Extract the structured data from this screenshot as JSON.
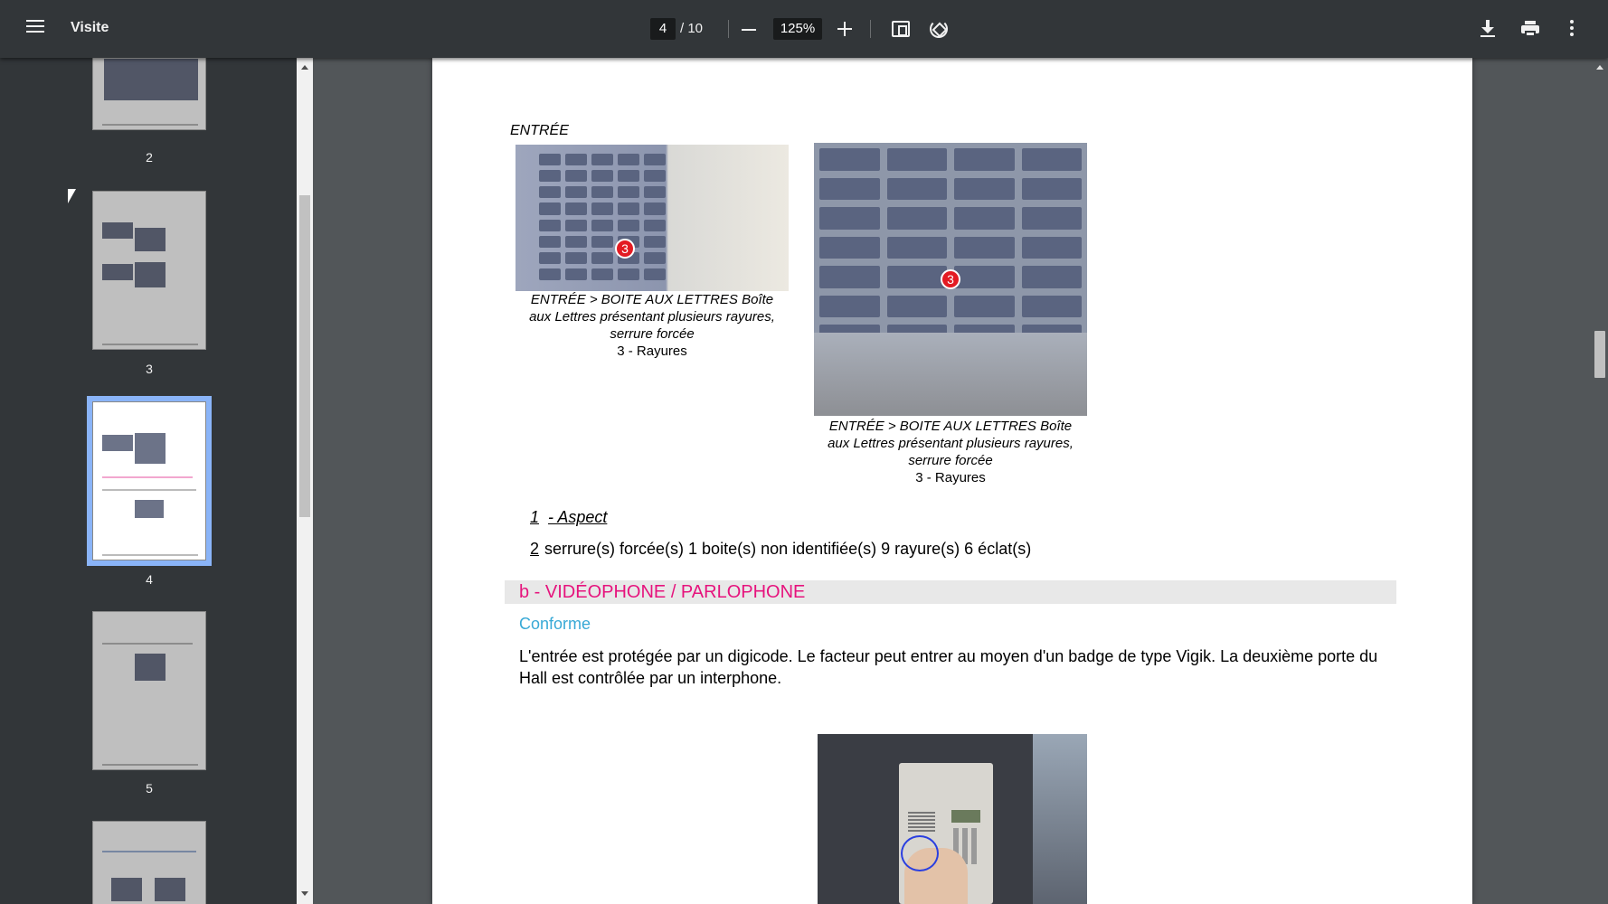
{
  "toolbar": {
    "title": "Visite",
    "current_page": "4",
    "page_total": "/ 10",
    "zoom": "125%"
  },
  "sidebar": {
    "thumbnails": [
      {
        "label": "2"
      },
      {
        "label": "3"
      },
      {
        "label": "4",
        "selected": true
      },
      {
        "label": "5"
      }
    ]
  },
  "document": {
    "section_heading": "ENTRÉE",
    "photo_left": {
      "marker": "3",
      "caption_line1": "ENTRÉE > BOITE AUX LETTRES Boîte",
      "caption_line2": "aux Lettres présentant plusieurs rayures,",
      "caption_line3": "serrure forcée",
      "caption_line4": "3 - Rayures"
    },
    "photo_right": {
      "marker": "3",
      "caption_line1": "ENTRÉE > BOITE AUX LETTRES Boîte",
      "caption_line2": "aux Lettres présentant plusieurs rayures,",
      "caption_line3": "serrure forcée",
      "caption_line4": "3 - Rayures"
    },
    "aspect": {
      "num": "1",
      "label": "- Aspect"
    },
    "counts": {
      "num": "2",
      "text": "serrure(s) forcée(s) 1 boite(s) non identifiée(s) 9 rayure(s) 6 éclat(s)"
    },
    "section_b": {
      "title": "b - VIDÉOPHONE / PARLOPHONE",
      "status": "Conforme",
      "paragraph": "L'entrée est protégée par un digicode. Le facteur peut entrer au moyen d'un badge de type Vigik. La deuxième porte du Hall est contrôlée par un interphone."
    }
  },
  "colors": {
    "toolbar_bg": "#323639",
    "viewer_bg": "#525659",
    "section_title": "#e6137d",
    "status": "#38a9d6",
    "marker": "#e31b23",
    "thumb_selected": "#8ab4f8"
  }
}
